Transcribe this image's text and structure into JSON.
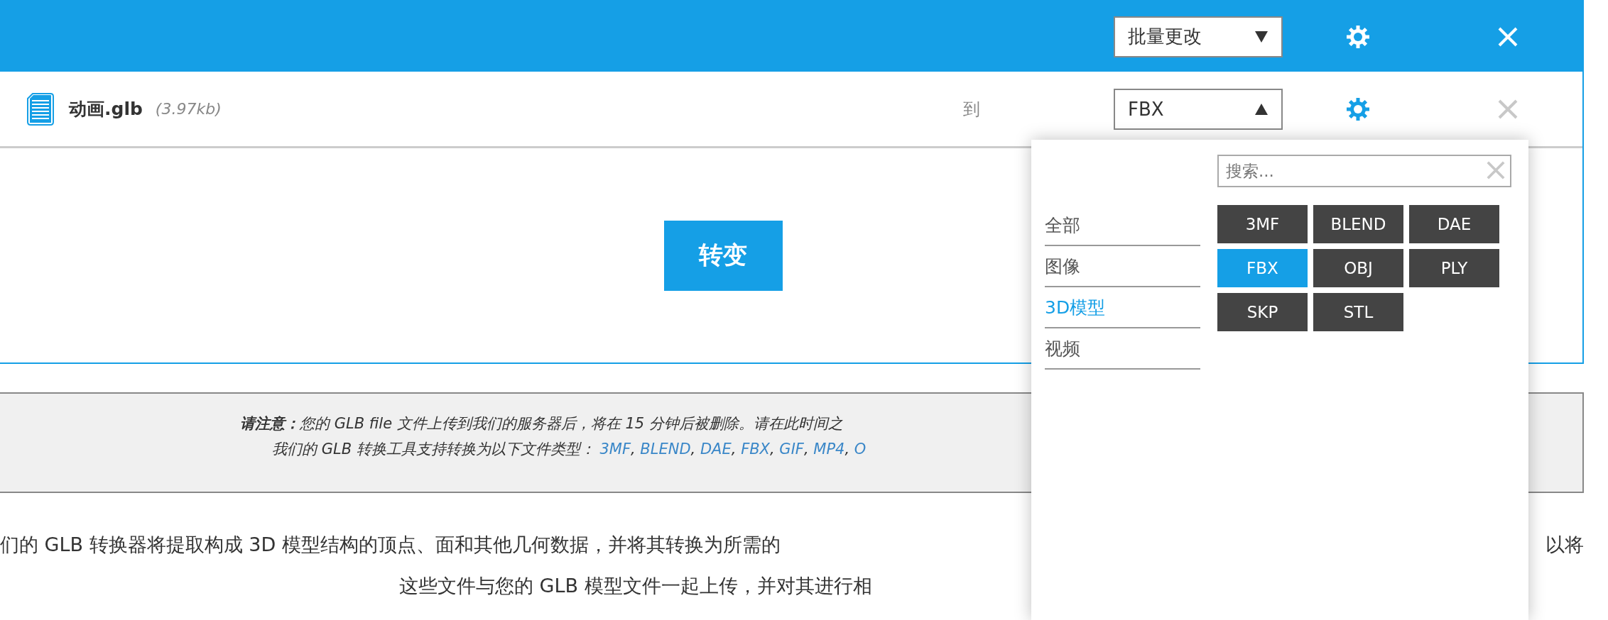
{
  "bulk_bar": {
    "select": {
      "value": "批量更改",
      "expanded": false
    }
  },
  "file": {
    "name": "动画.glb",
    "size": "(3.97kb)",
    "to_label": "到",
    "format_select": {
      "value": "FBX",
      "expanded": true
    }
  },
  "convert_button": "转变",
  "format_menu": {
    "search": {
      "placeholder": "搜索..."
    },
    "categories": [
      {
        "label": "全部",
        "selected": false
      },
      {
        "label": "图像",
        "selected": false
      },
      {
        "label": "3D模型",
        "selected": true
      },
      {
        "label": "视频",
        "selected": false
      }
    ],
    "formats": [
      {
        "label": "3MF",
        "selected": false
      },
      {
        "label": "BLEND",
        "selected": false
      },
      {
        "label": "DAE",
        "selected": false
      },
      {
        "label": "FBX",
        "selected": true
      },
      {
        "label": "OBJ",
        "selected": false
      },
      {
        "label": "PLY",
        "selected": false
      },
      {
        "label": "SKP",
        "selected": false
      },
      {
        "label": "STL",
        "selected": false
      }
    ]
  },
  "notice": {
    "text": "**请注意：**您的 GLB file 文件上传到我们的服务器后，将在 15 分钟后被删除。请在此时间之",
    "types_label": "我们的 GLB 转换工具支持转换为以下文件类型：",
    "types": [
      {
        "label": "3MF",
        "separator": ","
      },
      {
        "label": "BLEND",
        "separator": ","
      },
      {
        "label": "DAE",
        "separator": ","
      },
      {
        "label": "FBX",
        "separator": ","
      },
      {
        "label": "GIF",
        "separator": ","
      },
      {
        "label": "MP4",
        "separator": ","
      },
      {
        "label": "O"
      }
    ]
  },
  "description": {
    "line_1": "们的 GLB 转换器将提取构成 3D 模型结构的顶点、面和其他几何数据，并将其转换为所需的",
    "line_1_end": "以将",
    "line_2": "这些文件与您的 GLB 模型文件一起上传，并对其进行相"
  }
}
